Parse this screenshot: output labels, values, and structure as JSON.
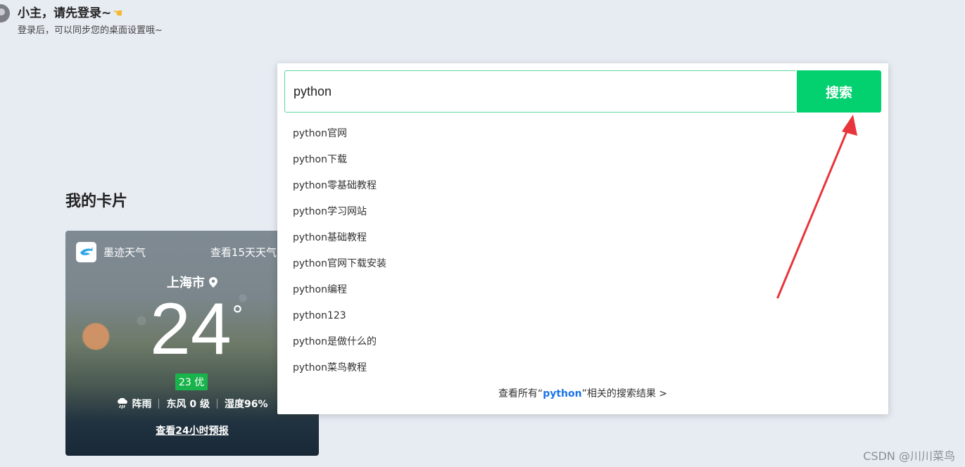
{
  "login": {
    "title": "小主，请先登录~",
    "subtitle": "登录后，可以同步您的桌面设置哦~"
  },
  "cards": {
    "title": "我的卡片"
  },
  "weather": {
    "brand": "墨迹天气",
    "forecast_15_label": "查看15天天气",
    "city": "上海市",
    "temperature": "24",
    "degree_symbol": "°",
    "aqi": "23 优",
    "condition": "阵雨",
    "wind": "东风 0 级",
    "humidity": "湿度96%",
    "forecast_24_label": "查看24小时预报"
  },
  "search": {
    "value": "python",
    "button_label": "搜索",
    "suggestions": [
      "python官网",
      "python下载",
      "python零基础教程",
      "python学习网站",
      "python基础教程",
      "python官网下载安装",
      "python编程",
      "python123",
      "python是做什么的",
      "python菜鸟教程"
    ],
    "view_all_prefix": "查看所有“",
    "view_all_keyword": "python",
    "view_all_suffix": "”相关的搜索结果 >"
  },
  "watermark": "CSDN @川川菜鸟",
  "colors": {
    "accent": "#03d170",
    "link": "#1a73e8",
    "arrow": "#e8353b",
    "aqi_badge": "#19b34b"
  }
}
